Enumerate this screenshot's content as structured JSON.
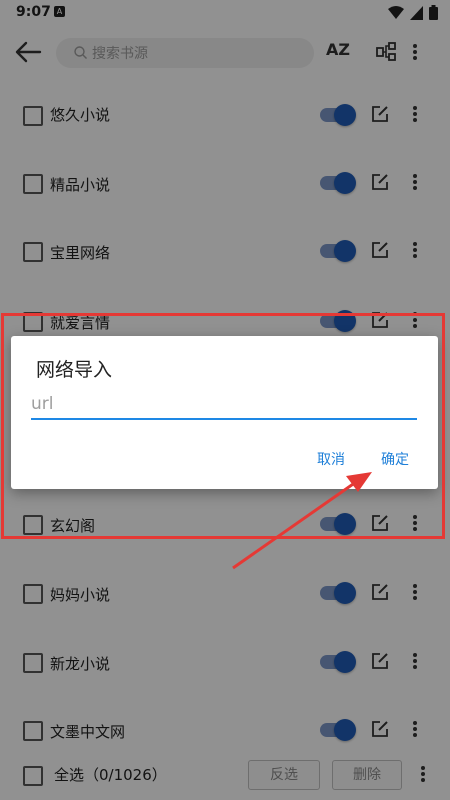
{
  "status_bar": {
    "time": "9:07",
    "notification_glyph": "A"
  },
  "app_bar": {
    "search_placeholder": "搜索书源",
    "sort_label": "AZ"
  },
  "sources": [
    {
      "name": "悠久小说",
      "checked": false,
      "enabled": true
    },
    {
      "name": "精品小说",
      "checked": false,
      "enabled": true
    },
    {
      "name": "宝里网络",
      "checked": false,
      "enabled": true
    },
    {
      "name": "就爱言情",
      "checked": false,
      "enabled": true
    },
    {
      "name": "玄幻阁",
      "checked": false,
      "enabled": true
    },
    {
      "name": "妈妈小说",
      "checked": false,
      "enabled": true
    },
    {
      "name": "新龙小说",
      "checked": false,
      "enabled": true
    },
    {
      "name": "文墨中文网",
      "checked": false,
      "enabled": true
    }
  ],
  "bottom_bar": {
    "select_all_label": "全选（0/1026）",
    "invert_label": "反选",
    "delete_label": "删除"
  },
  "dialog": {
    "title": "网络导入",
    "input_placeholder": "url",
    "input_value": "",
    "cancel_label": "取消",
    "confirm_label": "确定"
  },
  "colors": {
    "accent": "#1e7fd8",
    "switch_thumb": "#1f5bb4",
    "highlight_box": "#e53935"
  }
}
